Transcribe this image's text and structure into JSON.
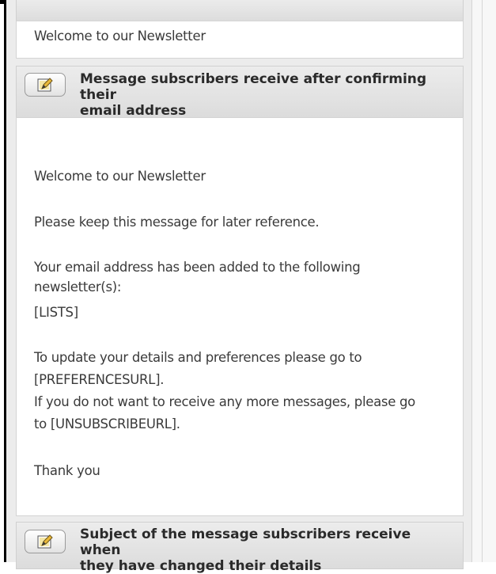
{
  "sections": [
    {
      "title_line1": "",
      "title_line2": "",
      "content_lines": [
        "Welcome to our Newsletter"
      ]
    },
    {
      "title_line1": "Message subscribers receive after confirming their",
      "title_line2": "email address",
      "edit_icon": "edit-icon",
      "content_lines": [
        "Welcome to our Newsletter",
        "Please keep this message for later reference.",
        "Your email address has been added to the following",
        "newsletter(s):",
        "[LISTS]",
        "To update your details and preferences please go to",
        "[PREFERENCESURL].",
        "If you do not want to receive any more messages, please go",
        "to [UNSUBSCRIBEURL].",
        "Thank you"
      ]
    },
    {
      "title_line1": "Subject of the message subscribers receive when",
      "title_line2": "they have changed their details",
      "edit_icon": "edit-icon"
    }
  ]
}
